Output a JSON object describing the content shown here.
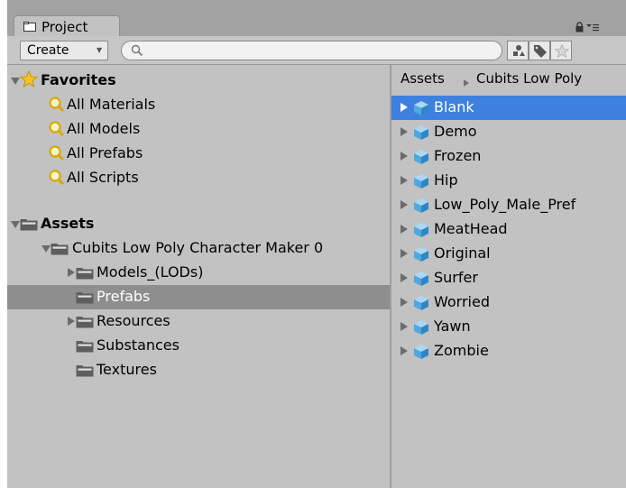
{
  "window": {
    "tab_label": "Project",
    "lock_icon": "lock-icon",
    "menu_icon": "menu-icon"
  },
  "toolbar": {
    "create_label": "Create",
    "search_placeholder": "",
    "buttons": [
      "filter-by-type-icon",
      "filter-by-label-icon",
      "favorite-star-icon"
    ]
  },
  "tree": {
    "favorites": {
      "label": "Favorites",
      "items": [
        "All Materials",
        "All Models",
        "All Prefabs",
        "All Scripts"
      ]
    },
    "assets": {
      "label": "Assets",
      "child": "Cubits Low Poly Character Maker 0",
      "folders": [
        "Models_(LODs)",
        "Prefabs",
        "Resources",
        "Substances",
        "Textures"
      ],
      "selected": "Prefabs"
    }
  },
  "breadcrumb": [
    "Assets",
    "Cubits Low Poly"
  ],
  "prefabs": {
    "items": [
      "Blank",
      "Demo",
      "Frozen",
      "Hip",
      "Low_Poly_Male_Pref",
      "MeatHead",
      "Original",
      "Surfer",
      "Worried",
      "Yawn",
      "Zombie"
    ],
    "selected": "Blank"
  },
  "colors": {
    "selection_blue": "#3d80df",
    "selection_gray": "#8e8e8e",
    "panel": "#c2c2c2",
    "prefab_cube": "#4fa8e0"
  }
}
